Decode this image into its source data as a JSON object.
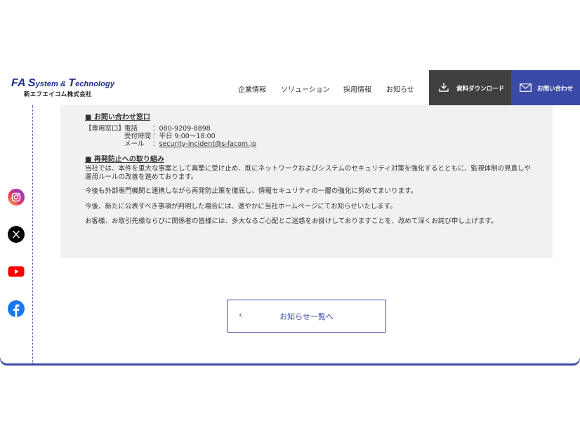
{
  "logo": {
    "main_fa": "FA",
    "main_s": "S",
    "main_ystem": "ystem & ",
    "main_t": "T",
    "main_echnology": "echnology",
    "sub": "新エフエイコム株式会社"
  },
  "nav": {
    "items": [
      "企業情報",
      "ソリューション",
      "採用情報",
      "お知らせ"
    ],
    "download_label": "資料ダウンロード",
    "contact_label": "お問い合わせ"
  },
  "social": {
    "icons": [
      "instagram-icon",
      "x-icon",
      "youtube-icon",
      "facebook-icon"
    ]
  },
  "article": {
    "contact_title": "■ お問い合わせ窓口",
    "contact_window_label": "【専用窓口】",
    "phone_label": "電話",
    "phone_value": "：080-9209-8898",
    "hours_label": "受付時間",
    "hours_value": "：平日 9:00〜18:00",
    "mail_label": "メール",
    "mail_colon": "：",
    "mail_value": "security-incident@s-facom.jp",
    "prevention_title": "■ 再発防止への取り組み",
    "paragraphs": [
      "当社では、本件を重大な事案として真摯に受け止め、既にネットワークおよびシステムのセキュリティ対策を強化するとともに、監視体制の見直しや運用ルールの改善を進めております。",
      "今後も外部専門機関と連携しながら再発防止策を徹底し、情報セキュリティの一層の強化に努めてまいります。",
      "今後、新たに公表すべき事項が判明した場合には、速やかに当社ホームページにてお知らせいたします。",
      "お客様、お取引先様ならびに関係者の皆様には、多大なるご心配とご迷惑をお掛けしておりますことを、改めて深くお詫び申し上げます。"
    ]
  },
  "back": {
    "chevron": "‹",
    "label": "お知らせ一覧へ"
  },
  "colors": {
    "brand": "#3b4aa6",
    "dark": "#404040",
    "panel": "#f1f1f1"
  }
}
